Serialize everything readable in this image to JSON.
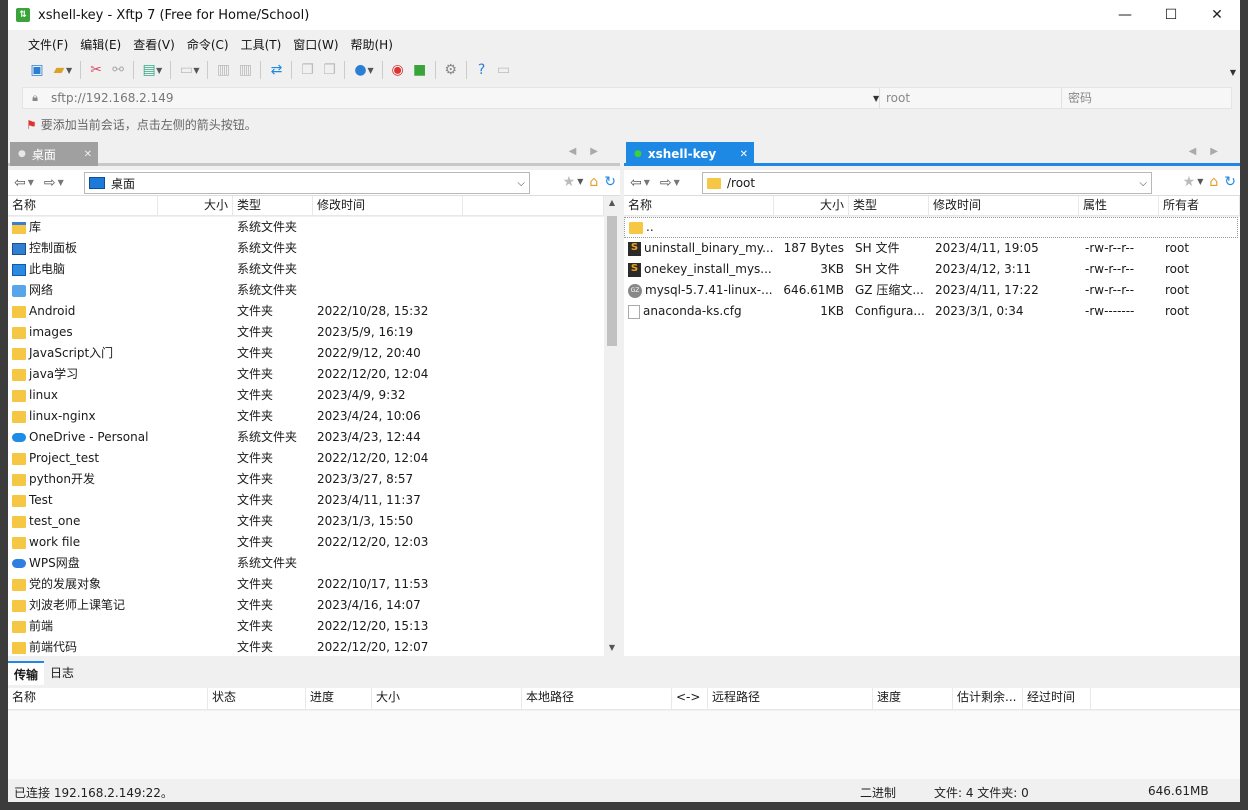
{
  "window": {
    "title": "xshell-key - Xftp 7 (Free for Home/School)",
    "minimize": "—",
    "maximize": "☐",
    "close": "✕"
  },
  "menu": [
    "文件(F)",
    "编辑(E)",
    "查看(V)",
    "命令(C)",
    "工具(T)",
    "窗口(W)",
    "帮助(H)"
  ],
  "address": {
    "url": "sftp://192.168.2.149",
    "user_placeholder": "root",
    "password_placeholder": "密码"
  },
  "hint": "要添加当前会话，点击左侧的箭头按钮。",
  "left_pane": {
    "tab_label": "桌面",
    "path": "桌面",
    "columns": [
      "名称",
      "大小",
      "类型",
      "修改时间"
    ],
    "rows": [
      {
        "icon": "library-icon",
        "name": "库",
        "size": "",
        "type": "系统文件夹",
        "modified": ""
      },
      {
        "icon": "control-panel-icon",
        "name": "控制面板",
        "size": "",
        "type": "系统文件夹",
        "modified": ""
      },
      {
        "icon": "computer-icon",
        "name": "此电脑",
        "size": "",
        "type": "系统文件夹",
        "modified": ""
      },
      {
        "icon": "network-icon",
        "name": "网络",
        "size": "",
        "type": "系统文件夹",
        "modified": ""
      },
      {
        "icon": "folder-icon",
        "name": "Android",
        "size": "",
        "type": "文件夹",
        "modified": "2022/10/28, 15:32"
      },
      {
        "icon": "folder-icon",
        "name": "images",
        "size": "",
        "type": "文件夹",
        "modified": "2023/5/9, 16:19"
      },
      {
        "icon": "folder-icon",
        "name": "JavaScript入门",
        "size": "",
        "type": "文件夹",
        "modified": "2022/9/12, 20:40"
      },
      {
        "icon": "folder-icon",
        "name": "java学习",
        "size": "",
        "type": "文件夹",
        "modified": "2022/12/20, 12:04"
      },
      {
        "icon": "folder-icon",
        "name": "linux",
        "size": "",
        "type": "文件夹",
        "modified": "2023/4/9, 9:32"
      },
      {
        "icon": "folder-icon",
        "name": "linux-nginx",
        "size": "",
        "type": "文件夹",
        "modified": "2023/4/24, 10:06"
      },
      {
        "icon": "onedrive-icon",
        "name": "OneDrive - Personal",
        "size": "",
        "type": "系统文件夹",
        "modified": "2023/4/23, 12:44"
      },
      {
        "icon": "folder-icon",
        "name": "Project_test",
        "size": "",
        "type": "文件夹",
        "modified": "2022/12/20, 12:04"
      },
      {
        "icon": "folder-icon",
        "name": "python开发",
        "size": "",
        "type": "文件夹",
        "modified": "2023/3/27, 8:57"
      },
      {
        "icon": "folder-icon",
        "name": "Test",
        "size": "",
        "type": "文件夹",
        "modified": "2023/4/11, 11:37"
      },
      {
        "icon": "folder-icon",
        "name": "test_one",
        "size": "",
        "type": "文件夹",
        "modified": "2023/1/3, 15:50"
      },
      {
        "icon": "folder-icon",
        "name": "work file",
        "size": "",
        "type": "文件夹",
        "modified": "2022/12/20, 12:03"
      },
      {
        "icon": "wps-cloud-icon",
        "name": "WPS网盘",
        "size": "",
        "type": "系统文件夹",
        "modified": ""
      },
      {
        "icon": "folder-icon",
        "name": "党的发展对象",
        "size": "",
        "type": "文件夹",
        "modified": "2022/10/17, 11:53"
      },
      {
        "icon": "folder-icon",
        "name": "刘波老师上课笔记",
        "size": "",
        "type": "文件夹",
        "modified": "2023/4/16, 14:07"
      },
      {
        "icon": "folder-icon",
        "name": "前端",
        "size": "",
        "type": "文件夹",
        "modified": "2022/12/20, 15:13"
      },
      {
        "icon": "folder-icon",
        "name": "前端代码",
        "size": "",
        "type": "文件夹",
        "modified": "2022/12/20, 12:07"
      }
    ]
  },
  "right_pane": {
    "tab_label": "xshell-key",
    "path": "/root",
    "columns": [
      "名称",
      "大小",
      "类型",
      "修改时间",
      "属性",
      "所有者"
    ],
    "parent_row": "..",
    "rows": [
      {
        "icon": "shell-script-icon",
        "name": "uninstall_binary_my...",
        "size": "187 Bytes",
        "type": "SH 文件",
        "modified": "2023/4/11, 19:05",
        "attrs": "-rw-r--r--",
        "owner": "root"
      },
      {
        "icon": "shell-script-icon",
        "name": "onekey_install_mys...",
        "size": "3KB",
        "type": "SH 文件",
        "modified": "2023/4/12, 3:11",
        "attrs": "-rw-r--r--",
        "owner": "root"
      },
      {
        "icon": "gz-archive-icon",
        "name": "mysql-5.7.41-linux-...",
        "size": "646.61MB",
        "type": "GZ 压缩文...",
        "modified": "2023/4/11, 17:22",
        "attrs": "-rw-r--r--",
        "owner": "root"
      },
      {
        "icon": "config-file-icon",
        "name": "anaconda-ks.cfg",
        "size": "1KB",
        "type": "Configura...",
        "modified": "2023/3/1, 0:34",
        "attrs": "-rw-------",
        "owner": "root"
      }
    ]
  },
  "bottom": {
    "tabs": [
      "传输",
      "日志"
    ],
    "columns": [
      "名称",
      "状态",
      "进度",
      "大小",
      "本地路径",
      "<->",
      "远程路径",
      "速度",
      "估计剩余...",
      "经过时间"
    ]
  },
  "status": {
    "connection": "已连接 192.168.2.149:22。",
    "mode": "二进制",
    "counts": "文件: 4  文件夹: 0",
    "total_size": "646.61MB"
  },
  "colors": {
    "accent": "#1e88e5",
    "inactive_tab": "#a0a0a0",
    "folder": "#f6c744"
  }
}
